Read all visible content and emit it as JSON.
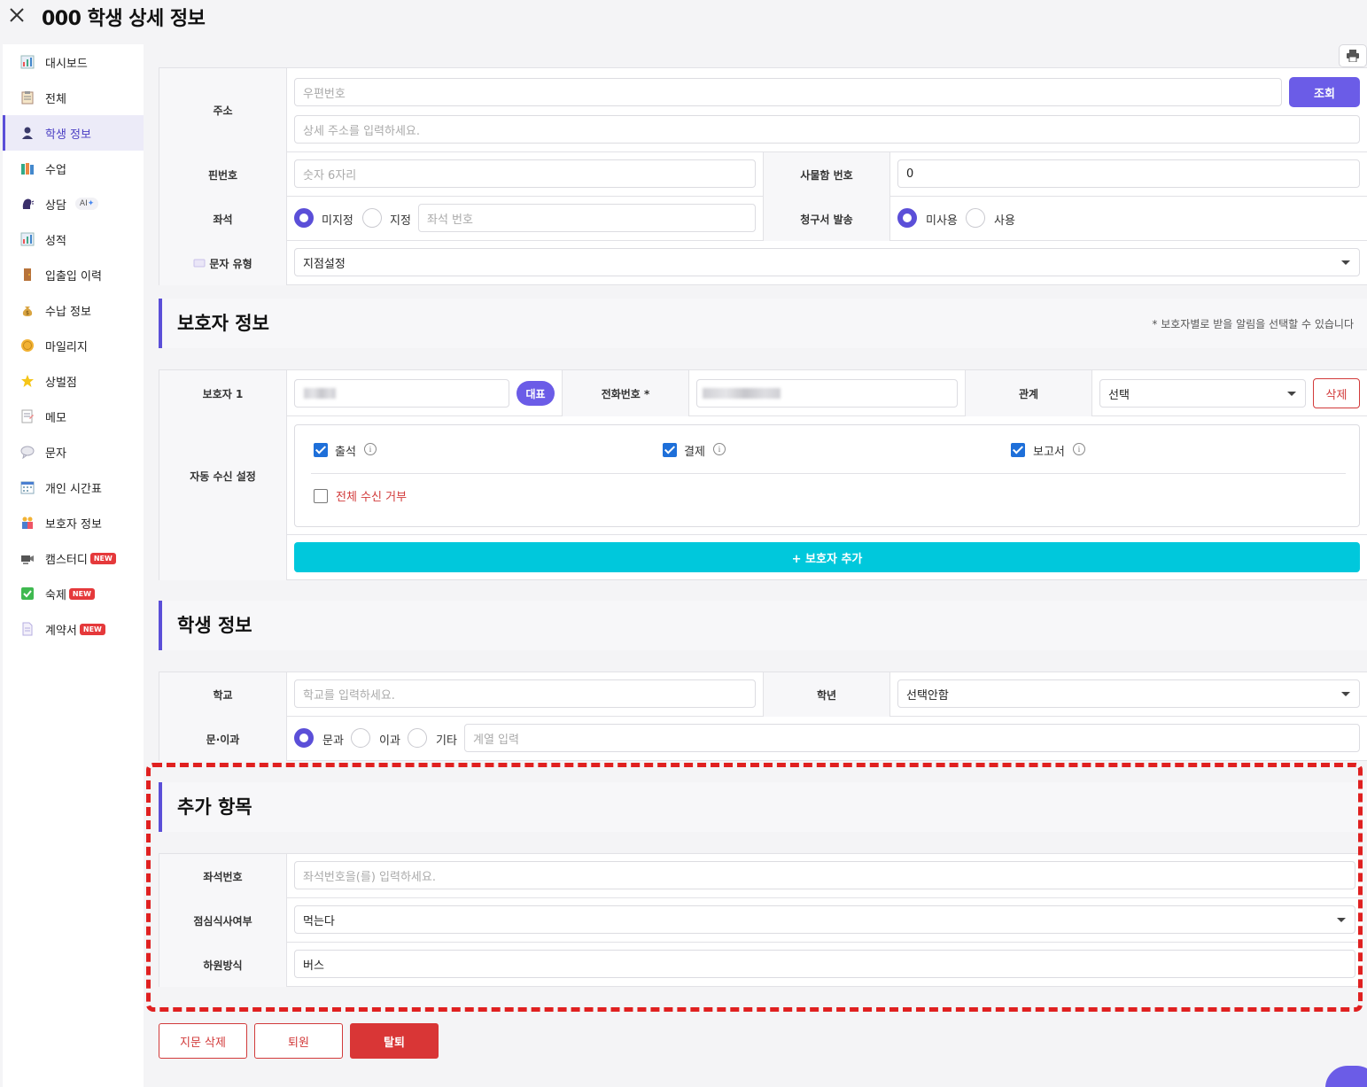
{
  "title": "000 학생 상세 정보",
  "sidebar": {
    "items": [
      {
        "label": "대시보드",
        "icon": "bar-chart-icon"
      },
      {
        "label": "전체",
        "icon": "clipboard-icon"
      },
      {
        "label": "학생 정보",
        "icon": "person-icon"
      },
      {
        "label": "수업",
        "icon": "books-icon"
      },
      {
        "label": "상담",
        "icon": "speaking-head-icon"
      },
      {
        "label": "성적",
        "icon": "bar-chart-icon"
      },
      {
        "label": "입출입 이력",
        "icon": "door-icon"
      },
      {
        "label": "수납 정보",
        "icon": "money-bag-icon"
      },
      {
        "label": "마일리지",
        "icon": "coin-icon"
      },
      {
        "label": "상벌점",
        "icon": "star-icon"
      },
      {
        "label": "메모",
        "icon": "memo-icon"
      },
      {
        "label": "문자",
        "icon": "speech-bubble-icon"
      },
      {
        "label": "개인 시간표",
        "icon": "calendar-icon"
      },
      {
        "label": "보호자 정보",
        "icon": "family-icon"
      },
      {
        "label": "캠스터디",
        "icon": "camera-icon"
      },
      {
        "label": "숙제",
        "icon": "check-box-icon"
      },
      {
        "label": "계약서",
        "icon": "document-icon"
      }
    ],
    "badge_new": "NEW",
    "badge_ai": "AI",
    "badge_ai_spark": "✦"
  },
  "address": {
    "label": "주소",
    "postcode_placeholder": "우편번호",
    "detail_placeholder": "상세 주소를 입력하세요.",
    "search_button": "조회"
  },
  "pin": {
    "label": "핀번호",
    "placeholder": "숫자 6자리"
  },
  "locker": {
    "label": "사물함 번호",
    "value": "0"
  },
  "seat": {
    "label": "좌석",
    "options": [
      "미지정",
      "지정"
    ],
    "selected": "미지정",
    "input_placeholder": "좌석 번호"
  },
  "invoice": {
    "label": "청구서 발송",
    "options": [
      "미사용",
      "사용"
    ],
    "selected": "미사용"
  },
  "sms_type": {
    "label": "문자 유형",
    "value": "지점설정"
  },
  "guardian_section": {
    "title": "보호자 정보",
    "note": "* 보호자별로 받을 알림을 선택할 수 있습니다"
  },
  "guardian1": {
    "label": "보호자 1",
    "primary_badge": "대표",
    "phone_label": "전화번호 *",
    "relation_label": "관계",
    "relation_value": "선택",
    "delete_button": "삭제",
    "auto_receive_label": "자동 수신 설정",
    "checks": [
      {
        "label": "출석",
        "checked": true
      },
      {
        "label": "결제",
        "checked": true
      },
      {
        "label": "보고서",
        "checked": true
      }
    ],
    "refuse_all": "전체 수신 거부",
    "add_button": "+ 보호자 추가"
  },
  "student_section": {
    "title": "학생 정보"
  },
  "school": {
    "label": "학교",
    "placeholder": "학교를 입력하세요."
  },
  "grade": {
    "label": "학년",
    "value": "선택안함"
  },
  "track": {
    "label": "문·이과",
    "options": [
      "문과",
      "이과",
      "기타"
    ],
    "selected": "문과",
    "input_placeholder": "계열 입력"
  },
  "extra_section": {
    "title": "추가 항목"
  },
  "extra": {
    "seat_no": {
      "label": "좌석번호",
      "placeholder": "좌석번호을(를) 입력하세요."
    },
    "lunch": {
      "label": "점심식사여부",
      "value": "먹는다"
    },
    "dismissal": {
      "label": "하원방식",
      "value": "버스"
    }
  },
  "footer": {
    "delete_fingerprint": "지문 삭제",
    "leave": "퇴원",
    "withdraw": "탈퇴"
  },
  "colors": {
    "accent": "#5b4fd8",
    "cyan": "#00c8dc",
    "danger": "#d93636",
    "highlight": "#e02020"
  }
}
